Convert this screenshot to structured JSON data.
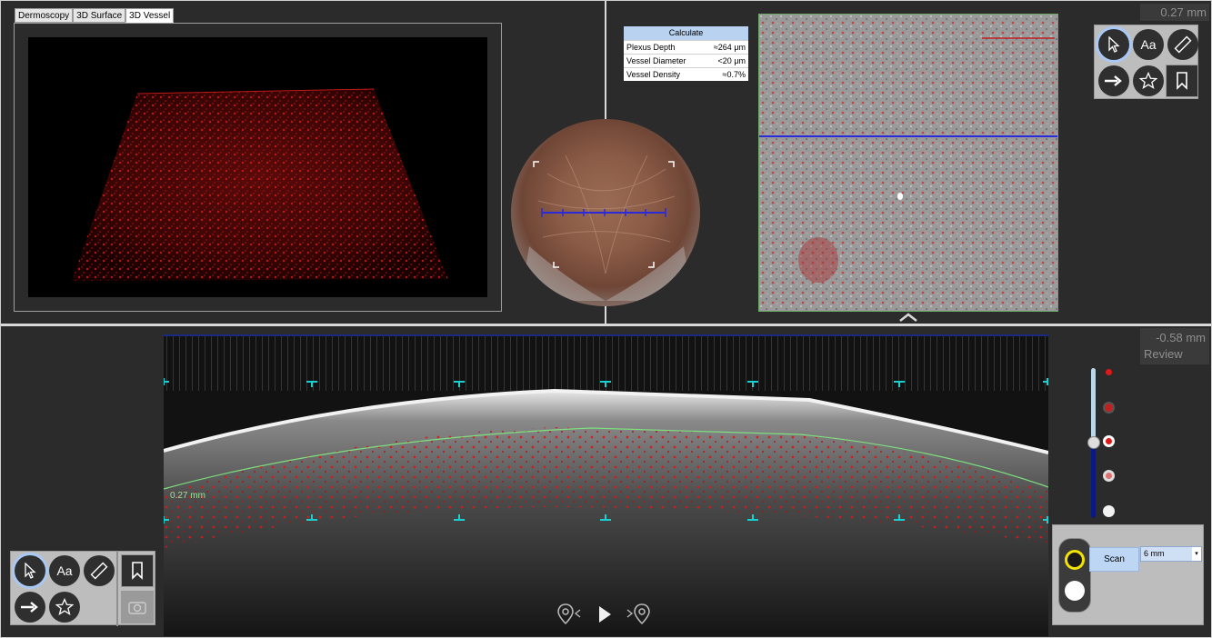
{
  "tabs": [
    {
      "label": "Dermoscopy",
      "active": false
    },
    {
      "label": "3D Surface",
      "active": false
    },
    {
      "label": "3D Vessel",
      "active": true
    }
  ],
  "calculate": {
    "title": "Calculate",
    "rows": [
      {
        "label": "Plexus Depth",
        "value": "≈264 μm"
      },
      {
        "label": "Vessel Diameter",
        "value": "<20 μm"
      },
      {
        "label": "Vessel Density",
        "value": "≈0.7%"
      }
    ]
  },
  "depth_top": "0.27 mm",
  "depth_bottom": "-0.58 mm",
  "review_label": "Review",
  "bscan_depth_label": "0.27 mm",
  "tools_top": {
    "pointer": "pointer-icon",
    "text": "Aa",
    "ruler": "ruler-icon",
    "arrow": "arrow-icon",
    "star": "star-icon",
    "bookmark": "bookmark-icon"
  },
  "scan": {
    "button_label": "Scan",
    "size_value": "6 mm",
    "dropdown_arrow": "▾"
  },
  "colors": {
    "accent_blue": "#b8d2f0",
    "vessel_red": "#e02020",
    "marker_cyan": "#19d0d0",
    "layer_green": "#7ee07e",
    "scan_line_blue": "#2a2ad8"
  }
}
